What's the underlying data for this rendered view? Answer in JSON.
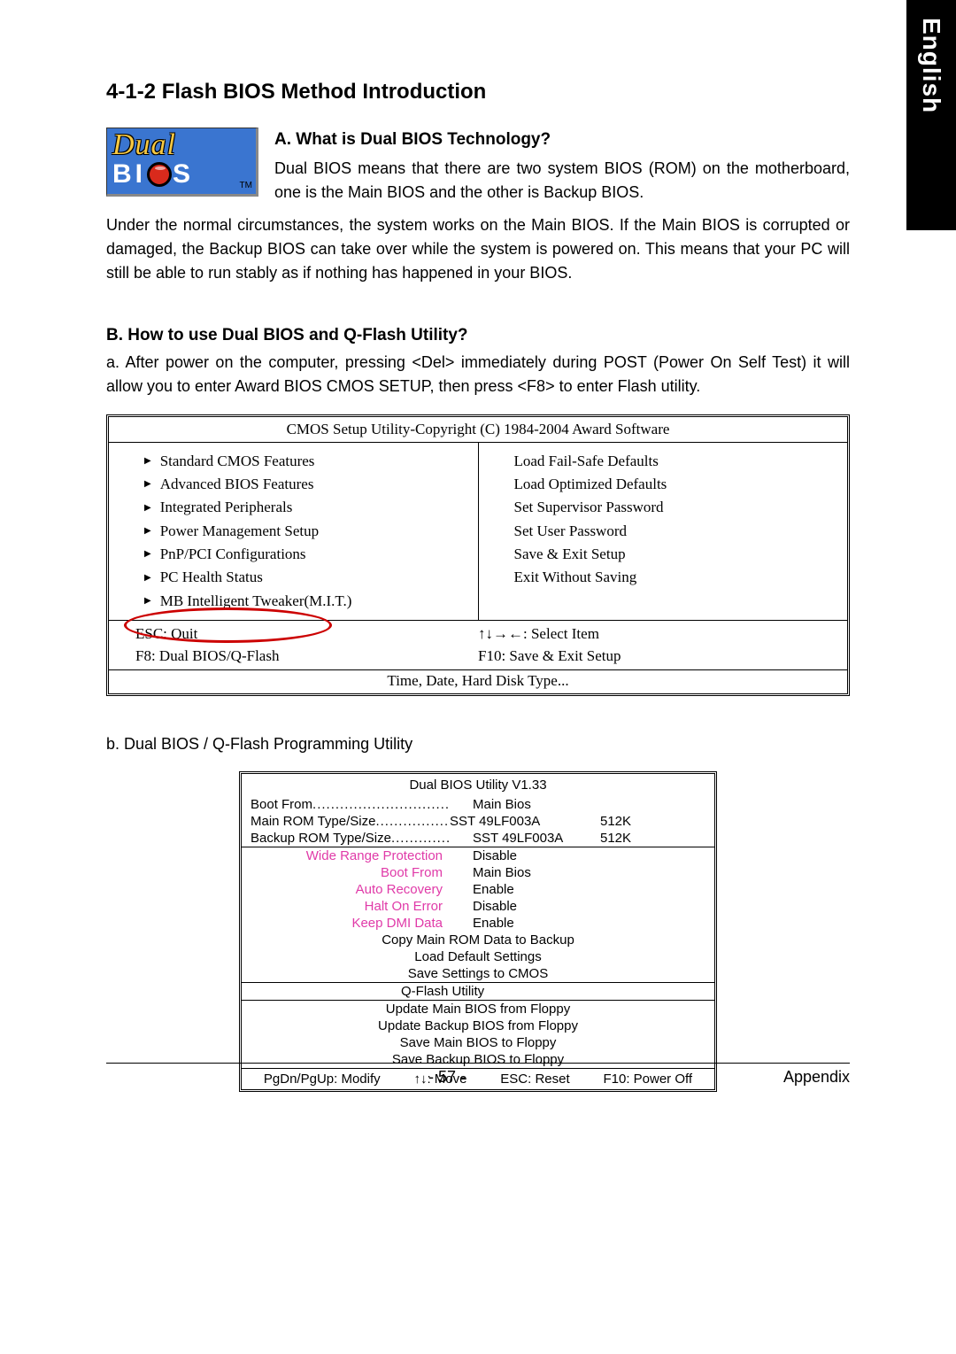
{
  "side_tab": "English",
  "section_title": "4-1-2   Flash BIOS Method Introduction",
  "logo": {
    "line1": "Dual",
    "line2_pre": "BI",
    "line2_post": "S",
    "tm": "TM"
  },
  "intro": {
    "heading": "A.   What is Dual BIOS Technology?",
    "p1": "Dual BIOS means that there are two system BIOS (ROM) on the motherboard, one is the Main BIOS and the other is Backup BIOS.",
    "p2": "Under the normal circumstances, the system works on the Main BIOS. If the Main BIOS is corrupted or damaged, the Backup BIOS can take over while the system is powered on. This means that your PC will still be able to run stably as if nothing has happened in your BIOS."
  },
  "sectionB": {
    "heading": "B.   How to use Dual BIOS and Q-Flash Utility?",
    "p": "a. After power on the computer, pressing <Del> immediately during POST (Power On Self Test) it will allow you to enter Award BIOS CMOS SETUP, then press <F8> to enter Flash utility."
  },
  "cmos": {
    "title": "CMOS Setup Utility-Copyright (C) 1984-2004 Award Software",
    "left": [
      "Standard CMOS Features",
      "Advanced BIOS Features",
      "Integrated Peripherals",
      "Power Management Setup",
      "PnP/PCI Configurations",
      "PC Health Status",
      "MB Intelligent Tweaker(M.I.T.)"
    ],
    "right": [
      "Load Fail-Safe Defaults",
      "Load Optimized Defaults",
      "Set Supervisor Password",
      "Set User Password",
      "Save & Exit Setup",
      "Exit Without Saving"
    ],
    "keys": {
      "l1": "ESC: Quit",
      "l2": "F8: Dual BIOS/Q-Flash",
      "r1": "↑↓→←: Select Item",
      "r2": "F10: Save & Exit Setup"
    },
    "hint": "Time, Date, Hard Disk Type..."
  },
  "stepb": "b.    Dual BIOS / Q-Flash Programming Utility",
  "qflash": {
    "title": "Dual BIOS Utility V1.33",
    "info": [
      {
        "label": "Boot From",
        "dots": "..................................................",
        "val": "Main Bios",
        "extra": ""
      },
      {
        "label": "Main ROM Type/Size",
        "dots": "..............................",
        "val": "SST 49LF003A",
        "extra": "512K"
      },
      {
        "label": "Backup ROM Type/Size",
        "dots": "..........................",
        "val": "SST 49LF003A",
        "extra": "512K"
      }
    ],
    "settings": [
      {
        "label": "Wide Range Protection",
        "val": "Disable"
      },
      {
        "label": "Boot From",
        "val": "Main Bios"
      },
      {
        "label": "Auto Recovery",
        "val": "Enable"
      },
      {
        "label": "Halt On Error",
        "val": "Disable"
      },
      {
        "label": "Keep DMI Data",
        "val": "Enable"
      }
    ],
    "actions1": [
      "Copy Main ROM Data to Backup",
      "Load Default Settings",
      "Save Settings to CMOS"
    ],
    "qflash_label": "Q-Flash Utility",
    "actions2": [
      "Update Main BIOS from Floppy",
      "Update Backup BIOS from Floppy",
      "Save Main BIOS to Floppy",
      "Save Backup BIOS to Floppy"
    ],
    "foot": [
      "PgDn/PgUp: Modify",
      "↑↓: Move",
      "ESC: Reset",
      "F10: Power Off"
    ]
  },
  "footer": {
    "page": "- 57 -",
    "section": "Appendix"
  }
}
